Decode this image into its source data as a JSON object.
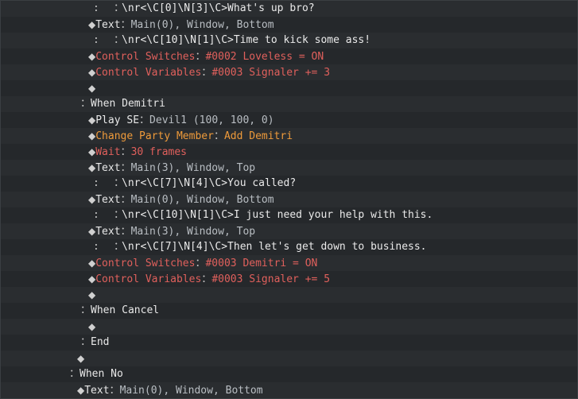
{
  "rows": [
    {
      "indent": 116,
      "kind": "cont",
      "text": "\\nr<\\C[0]\\N[3]\\C>What's up bro?"
    },
    {
      "indent": 110,
      "kind": "cmd",
      "cmd": "Text",
      "args": "Main(0), Window, Bottom",
      "color": "white"
    },
    {
      "indent": 116,
      "kind": "cont",
      "text": "\\nr<\\C[10]\\N[1]\\C>Time to kick some ass!"
    },
    {
      "indent": 110,
      "kind": "cmd",
      "cmd": "Control Switches",
      "args": "#0002 Loveless = ON",
      "color": "red"
    },
    {
      "indent": 110,
      "kind": "cmd",
      "cmd": "Control Variables",
      "args": "#0003 Signaler += 3",
      "color": "red"
    },
    {
      "indent": 110,
      "kind": "empty"
    },
    {
      "indent": 100,
      "kind": "branch",
      "text": "When Demitri"
    },
    {
      "indent": 110,
      "kind": "cmd",
      "cmd": "Play SE",
      "args": "Devil1 (100, 100, 0)",
      "color": "white"
    },
    {
      "indent": 110,
      "kind": "cmd",
      "cmd": "Change Party Member",
      "args": "Add Demitri",
      "color": "orange"
    },
    {
      "indent": 110,
      "kind": "cmd",
      "cmd": "Wait",
      "args": "30 frames",
      "color": "red"
    },
    {
      "indent": 110,
      "kind": "cmd",
      "cmd": "Text",
      "args": "Main(3), Window, Top",
      "color": "white"
    },
    {
      "indent": 116,
      "kind": "cont",
      "text": "\\nr<\\C[7]\\N[4]\\C>You called?"
    },
    {
      "indent": 110,
      "kind": "cmd",
      "cmd": "Text",
      "args": "Main(0), Window, Bottom",
      "color": "white"
    },
    {
      "indent": 116,
      "kind": "cont",
      "text": "\\nr<\\C[10]\\N[1]\\C>I just need your help with this."
    },
    {
      "indent": 110,
      "kind": "cmd",
      "cmd": "Text",
      "args": "Main(3), Window, Top",
      "color": "white"
    },
    {
      "indent": 116,
      "kind": "cont",
      "text": "\\nr<\\C[7]\\N[4]\\C>Then let's get down to business."
    },
    {
      "indent": 110,
      "kind": "cmd",
      "cmd": "Control Switches",
      "args": "#0003 Demitri = ON",
      "color": "red"
    },
    {
      "indent": 110,
      "kind": "cmd",
      "cmd": "Control Variables",
      "args": "#0003 Signaler += 5",
      "color": "red"
    },
    {
      "indent": 110,
      "kind": "empty"
    },
    {
      "indent": 100,
      "kind": "branch",
      "text": "When Cancel"
    },
    {
      "indent": 110,
      "kind": "empty"
    },
    {
      "indent": 100,
      "kind": "branch",
      "text": "End"
    },
    {
      "indent": 96,
      "kind": "empty"
    },
    {
      "indent": 86,
      "kind": "branch",
      "text": "When No"
    },
    {
      "indent": 96,
      "kind": "cmd",
      "cmd": "Text",
      "args": "Main(0), Window, Bottom",
      "color": "white"
    }
  ],
  "glyphs": {
    "diamond": "◆",
    "colon": "：",
    "cont_prefix": ":"
  }
}
